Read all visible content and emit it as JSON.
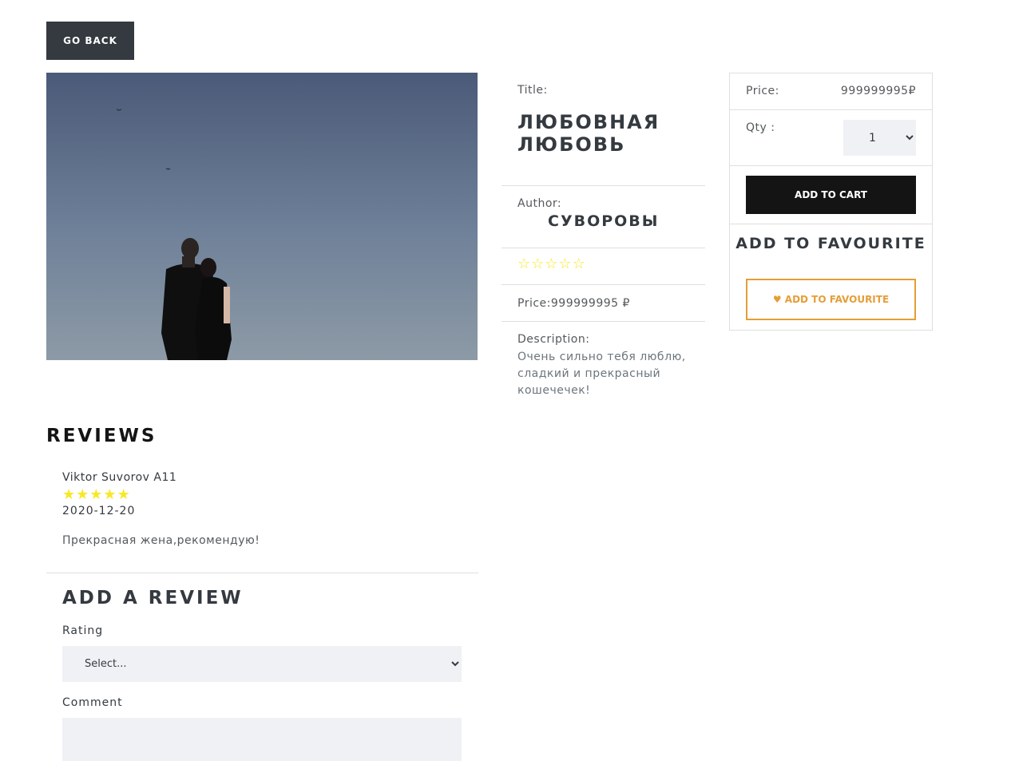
{
  "nav": {
    "back_label": "Go Back"
  },
  "product": {
    "title_label": "Title:",
    "title": "Любовная любовь",
    "author_label": "Author:",
    "author": "Суворовы",
    "rating": 0,
    "rating_max": 5,
    "price_label": "Price:",
    "price": "999999995 ₽",
    "description_label": "Description:",
    "description": "Очень сильно тебя люблю, сладкий и прекрасный кошечечек!"
  },
  "purchase": {
    "price_label": "Price:",
    "price": "999999995₽",
    "qty_label": "Qty :",
    "qty_selected": "1",
    "add_to_cart": "Add To Cart",
    "favourite_heading": "Add to favourite",
    "favourite_button": "Add to favourite",
    "colors": {
      "favourite": "#e59e37",
      "star": "#f8e825"
    }
  },
  "reviews": {
    "heading": "Reviews",
    "items": [
      {
        "author": "Viktor Suvorov A11",
        "rating": 5,
        "date": "2020-12-20",
        "comment": "Прекрасная жена,рекомендую!"
      }
    ]
  },
  "review_form": {
    "heading": "Add a review",
    "rating_label": "Rating",
    "rating_placeholder": "Select...",
    "comment_label": "Comment"
  }
}
